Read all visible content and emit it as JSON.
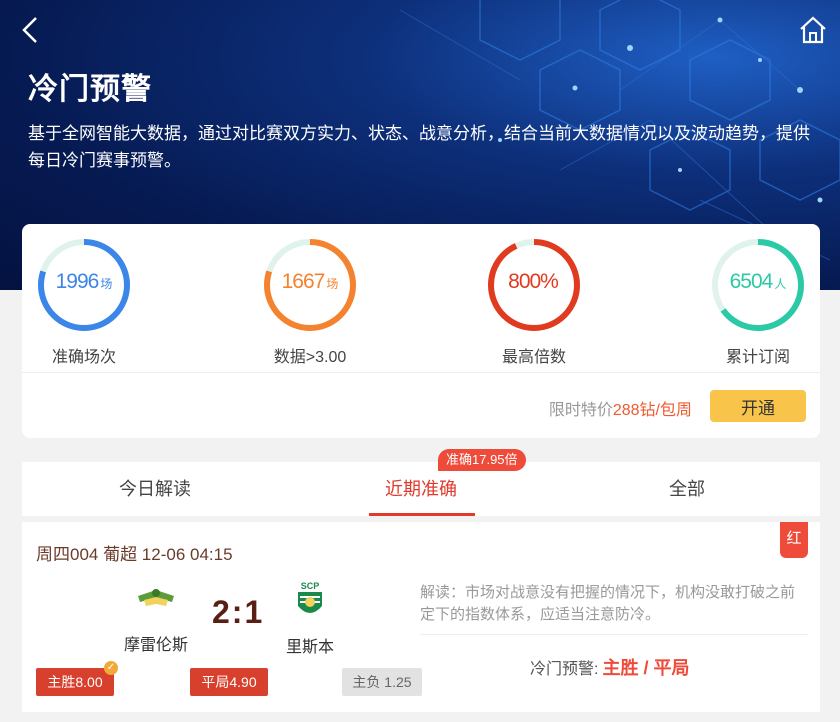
{
  "header": {
    "title": "冷门预警",
    "description": "基于全网智能大数据，通过对比赛双方实力、状态、战意分析，结合当前大数据情况以及波动趋势，提供每日冷门赛事预警。"
  },
  "stats": [
    {
      "value": "1996",
      "unit": "场",
      "label": "准确场次",
      "color": "#3b86e8",
      "fill": 0.8
    },
    {
      "value": "1667",
      "unit": "场",
      "label": "数据>3.00",
      "color": "#f5822e",
      "fill": 0.8
    },
    {
      "value": "800%",
      "unit": "",
      "label": "最高倍数",
      "color": "#e03a1f",
      "fill": 0.93
    },
    {
      "value": "6504",
      "unit": "人",
      "label": "累计订阅",
      "color": "#2cc9a6",
      "fill": 0.65
    }
  ],
  "promo": {
    "prefix": "限时特价",
    "price": "288钻/包周",
    "button": "开通"
  },
  "tabs": {
    "items": [
      "今日解读",
      "近期准确",
      "全部"
    ],
    "active_index": 1,
    "badge": "准确17.95倍"
  },
  "match": {
    "header": "周四004 葡超 12-06 04:15",
    "result_tag": "红",
    "home_team": "摩雷伦斯",
    "away_team": "里斯本",
    "score": "2:1",
    "odds": {
      "home_win": "主胜8.00",
      "draw": "平局4.90",
      "away_win": "主负 1.25"
    },
    "analysis": "解读：市场对战意没有把握的情况下，机构没敢打破之前定下的指数体系，应适当注意防冷。",
    "warning_label": "冷门预警:",
    "warning_value": "主胜 / 平局"
  }
}
